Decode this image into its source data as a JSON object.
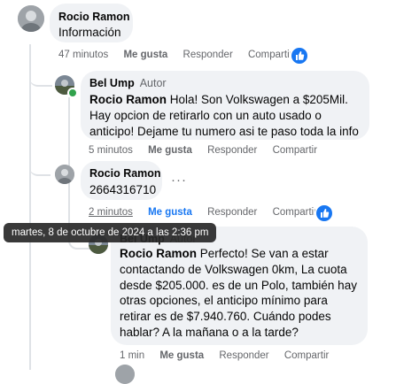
{
  "comments": [
    {
      "author": "Rocio Ramon",
      "text": "Información",
      "time": "47 minutos",
      "like_label": "Me gusta",
      "reply_label": "Responder",
      "share_label": "Compartir"
    },
    {
      "author": "Bel Ump",
      "author_tag": "Autor",
      "mention": "Rocio Ramon",
      "lines": [
        " Hola! Son Volkswagen a $205Mil.",
        "Hay opcion de retirarlo con un auto usado o",
        "anticipo! Dejame tu numero asi te paso toda la info"
      ],
      "time": "5 minutos",
      "like_label": "Me gusta",
      "reply_label": "Responder",
      "share_label": "Compartir"
    },
    {
      "author": "Rocio Ramon",
      "text": "2664316710",
      "time": "2 minutos",
      "like_label": "Me gusta",
      "reply_label": "Responder",
      "share_label": "Compartir",
      "more_label": "···"
    },
    {
      "author": "Bel Ump",
      "author_tag": "Autor",
      "mention": "Rocio Ramon",
      "lines": [
        " Perfecto! Se van a estar",
        "contactando de Volkswagen 0km, La cuota",
        "desde $205.000. es de un Polo, también hay",
        "otras opciones, el anticipo mínimo para",
        "retirar es de $7.940.760. Cuándo podes",
        "hablar? A la mañana o a la tarde?"
      ],
      "time": "1 min",
      "like_label": "Me gusta",
      "reply_label": "Responder",
      "share_label": "Compartir"
    }
  ],
  "tooltip": "martes, 8 de octubre de 2024 a las 2:36 pm",
  "colors": {
    "bubble": "#f0f2f5",
    "meta": "#65676b",
    "like_blue": "#1877f2",
    "online_green": "#31a24c"
  }
}
